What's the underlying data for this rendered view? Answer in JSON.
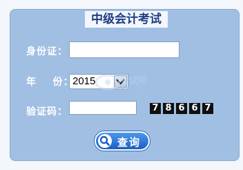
{
  "form": {
    "title": "中级会计考试",
    "id_label": "身份证：",
    "id_value": "",
    "year_label": "年    份：",
    "year_selected": "2015",
    "captcha_label": "验证码：",
    "captcha_value": "",
    "captcha_digits": [
      "7",
      "8",
      "6",
      "6",
      "7"
    ],
    "submit_label": "查询"
  },
  "watermark": {
    "text": "考试吧",
    "sub": ".com"
  },
  "colors": {
    "panel_bg": "#a1bfe3",
    "title": "#1f3d85",
    "button": "#1a5fc4"
  },
  "icons": {
    "select_arrow": "chevron-down-icon",
    "search": "search-icon"
  }
}
